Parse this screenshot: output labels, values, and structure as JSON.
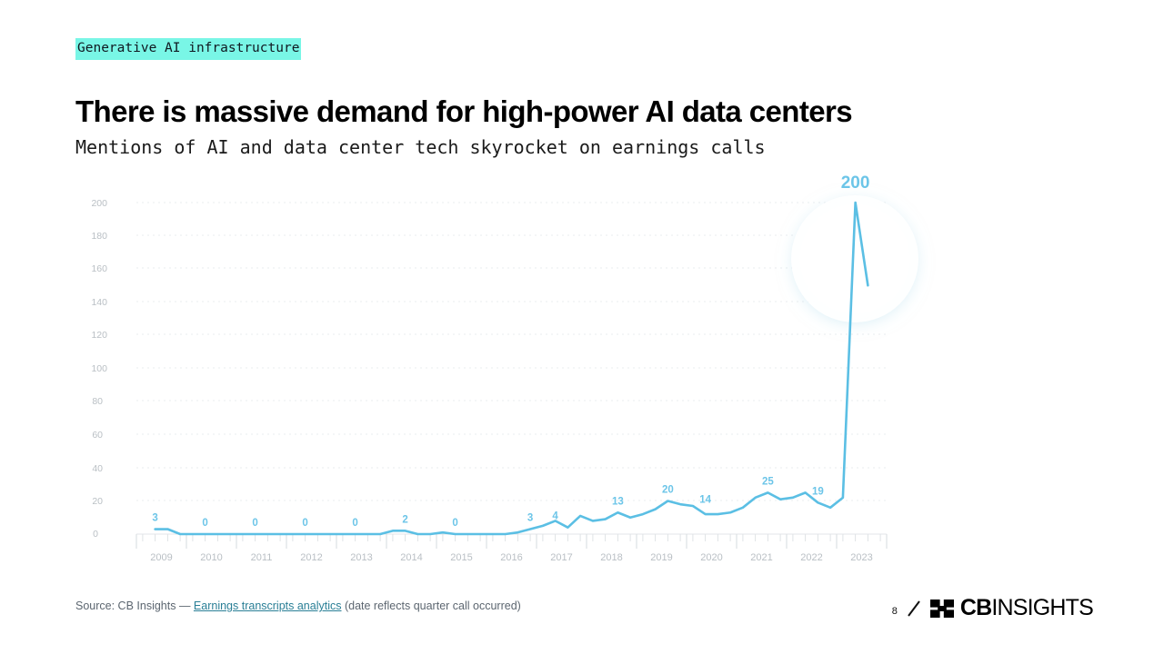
{
  "slide": {
    "eyebrow": "Generative AI infrastructure",
    "title": "There is massive demand for high-power AI data centers",
    "subtitle": "Mentions of AI and data center tech skyrocket on earnings calls",
    "accent_highlight_color": "#79f6e6",
    "line_color": "#5bbfe4",
    "label_color": "#6cc5e8"
  },
  "footer": {
    "source_prefix": "Source: CB Insights — ",
    "source_link": "Earnings transcripts analytics",
    "source_suffix": " (date reflects quarter call occurred)",
    "page_number": "8",
    "logo_cb": "CB",
    "logo_insights": "INSIGHTS",
    "slash_icon": "slash-divider-icon",
    "logo_mark_icon": "cbinsights-logo-mark-icon"
  },
  "chart_data": {
    "type": "line",
    "title": "Mentions of AI and data center tech skyrocket on earnings calls",
    "xlabel": "",
    "ylabel": "",
    "ylim": [
      0,
      200
    ],
    "yticks": [
      0,
      20,
      40,
      60,
      80,
      100,
      120,
      140,
      160,
      180,
      200
    ],
    "ytick_labels": [
      "0",
      "20",
      "40",
      "60",
      "80",
      "100",
      "120",
      "140",
      "160",
      "180",
      "200"
    ],
    "xtick_labels": [
      "2009",
      "2010",
      "2011",
      "2012",
      "2013",
      "2014",
      "2015",
      "2016",
      "2017",
      "2018",
      "2019",
      "2020",
      "2021",
      "2022",
      "2023"
    ],
    "x_minor_ticks_per_year": 4,
    "grid": "dotted-horizontal-faint",
    "legend": "none",
    "series": [
      {
        "name": "Mentions of AI and data center tech on earnings calls",
        "color": "#5bbfe4",
        "x": [
          "2009Q2",
          "2009Q3",
          "2009Q4",
          "2010Q1",
          "2010Q2",
          "2010Q3",
          "2010Q4",
          "2011Q1",
          "2011Q2",
          "2011Q3",
          "2011Q4",
          "2012Q1",
          "2012Q2",
          "2012Q3",
          "2012Q4",
          "2013Q1",
          "2013Q2",
          "2013Q3",
          "2013Q4",
          "2014Q1",
          "2014Q2",
          "2014Q3",
          "2014Q4",
          "2015Q1",
          "2015Q2",
          "2015Q3",
          "2015Q4",
          "2016Q1",
          "2016Q2",
          "2016Q3",
          "2016Q4",
          "2017Q1",
          "2017Q2",
          "2017Q3",
          "2017Q4",
          "2018Q1",
          "2018Q2",
          "2018Q3",
          "2018Q4",
          "2019Q1",
          "2019Q2",
          "2019Q3",
          "2019Q4",
          "2020Q1",
          "2020Q2",
          "2020Q3",
          "2020Q4",
          "2021Q1",
          "2021Q2",
          "2021Q3",
          "2021Q4",
          "2022Q1",
          "2022Q2",
          "2022Q3",
          "2022Q4",
          "2023Q1",
          "2023Q2",
          "2023Q3"
        ],
        "values": [
          3,
          3,
          0,
          0,
          0,
          0,
          0,
          0,
          0,
          0,
          0,
          0,
          0,
          0,
          0,
          0,
          0,
          0,
          0,
          2,
          2,
          0,
          0,
          1,
          0,
          0,
          0,
          0,
          0,
          1,
          3,
          5,
          8,
          4,
          11,
          8,
          9,
          13,
          10,
          12,
          15,
          20,
          18,
          17,
          12,
          12,
          13,
          16,
          22,
          25,
          21,
          22,
          25,
          19,
          16,
          22,
          200,
          150
        ]
      }
    ],
    "point_labels": [
      {
        "label": "3",
        "x": "2009Q2",
        "value": 3
      },
      {
        "label": "0",
        "x": "2010Q2",
        "value": 0
      },
      {
        "label": "0",
        "x": "2011Q2",
        "value": 0
      },
      {
        "label": "0",
        "x": "2012Q2",
        "value": 0
      },
      {
        "label": "0",
        "x": "2013Q2",
        "value": 0
      },
      {
        "label": "2",
        "x": "2014Q2",
        "value": 2
      },
      {
        "label": "0",
        "x": "2015Q2",
        "value": 0
      },
      {
        "label": "3",
        "x": "2016Q4",
        "value": 3
      },
      {
        "label": "4",
        "x": "2017Q2",
        "value": 4
      },
      {
        "label": "13",
        "x": "2018Q3",
        "value": 13
      },
      {
        "label": "20",
        "x": "2019Q3",
        "value": 20
      },
      {
        "label": "14",
        "x": "2020Q2",
        "value": 14
      },
      {
        "label": "25",
        "x": "2021Q3",
        "value": 25
      },
      {
        "label": "19",
        "x": "2022Q3",
        "value": 19
      },
      {
        "label": "200",
        "x": "2023Q2",
        "value": 200,
        "highlight": true
      }
    ],
    "callout": {
      "value_label": "200",
      "style": "circular-spotlight"
    }
  }
}
